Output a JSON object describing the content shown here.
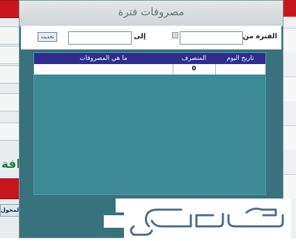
{
  "window": {
    "title": "مصروفات فترة"
  },
  "filter": {
    "from_label": "الفترة من",
    "from_value": "",
    "to_label": "إلى",
    "to_value": "",
    "refresh_label": "تحديث"
  },
  "grid": {
    "columns": [
      "تاريخ اليوم",
      "المنصرف",
      "ما هي المصروفات"
    ],
    "rows": [
      {
        "date": "",
        "spent": "0",
        "expense": ""
      }
    ]
  },
  "background": {
    "green_title_fragment": "افة",
    "bottom_label": "المخول"
  },
  "watermark": {
    "text": "حراج"
  },
  "colors": {
    "window_bg": "#38727c",
    "grid_header": "#2d2e8e",
    "grid_bg": "#3b8a94",
    "accent_red": "#c8161d",
    "accent_green": "#1e7d49"
  }
}
